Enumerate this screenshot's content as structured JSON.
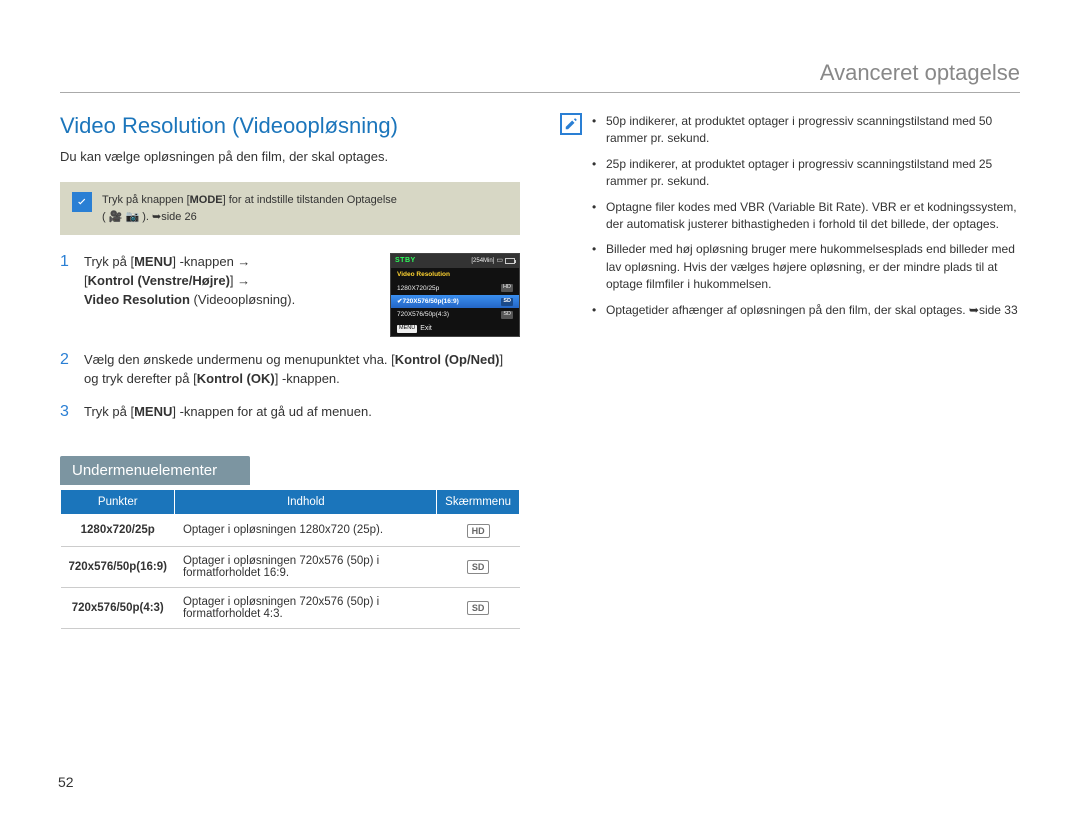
{
  "page_number": "52",
  "chapter_title": "Avanceret optagelse",
  "section_title": "Video Resolution (Videoopløsning)",
  "intro_text": "Du kan vælge opløsningen på den film, der skal optages.",
  "gray_box": {
    "text_prefix": "Tryk på knappen [",
    "mode_label": "MODE",
    "text_suffix": "] for at indstille tilstanden Optagelse",
    "icons_line": "( 🎥 📷 ). ",
    "ref": "➥side 26"
  },
  "steps": {
    "s1": {
      "num": "1",
      "parts": {
        "a": "Tryk på [",
        "menu": "MENU",
        "b": "] -knappen ",
        "arrow1": "→",
        "c": " [",
        "kontrol_lr": "Kontrol (Venstre/Højre)",
        "d": "] ",
        "arrow2": "→",
        "e": " ",
        "vr": "Video Resolution",
        "f": " (Videoopløsning)."
      }
    },
    "s2": {
      "num": "2",
      "parts": {
        "a": "Vælg den ønskede undermenu og menupunktet vha. [",
        "kontrol_ud": "Kontrol (Op/Ned)",
        "b": "] og tryk derefter på [",
        "kontrol_ok": "Kontrol (OK)",
        "c": "] -knappen."
      }
    },
    "s3": {
      "num": "3",
      "parts": {
        "a": "Tryk på [",
        "menu": "MENU",
        "b": "] -knappen for at gå ud af menuen."
      }
    }
  },
  "camera_menu": {
    "stby": "STBY",
    "time": "[254Min]",
    "title": "Video Resolution",
    "items": [
      {
        "label": "1280X720/25p",
        "badge": "HD"
      },
      {
        "label": "720X576/50p(16:9)",
        "badge": "SD"
      },
      {
        "label": "720X576/50p(4:3)",
        "badge": "SD"
      }
    ],
    "menu_btn": "MENU",
    "exit": "Exit"
  },
  "submenu_header": "Undermenuelementer",
  "table": {
    "headers": {
      "punkter": "Punkter",
      "indhold": "Indhold",
      "skaerm": "Skærmmenu"
    },
    "rows": [
      {
        "punkter": "1280x720/25p",
        "indhold": "Optager i opløsningen 1280x720 (25p).",
        "badge": "HD"
      },
      {
        "punkter": "720x576/50p(16:9)",
        "indhold": "Optager i opløsningen 720x576 (50p) i formatforholdet 16:9.",
        "badge": "SD"
      },
      {
        "punkter": "720x576/50p(4:3)",
        "indhold": "Optager i opløsningen 720x576 (50p) i formatforholdet 4:3.",
        "badge": "SD"
      }
    ]
  },
  "notes": [
    "50p indikerer, at produktet optager i progressiv scanningstilstand med 50 rammer pr. sekund.",
    "25p indikerer, at produktet optager i progressiv scanningstilstand med 25 rammer pr. sekund.",
    "Optagne filer kodes med VBR (Variable Bit Rate). VBR er et kodningssystem, der automatisk justerer bithastigheden i forhold til det billede, der optages.",
    "Billeder med høj opløsning bruger mere hukommelsesplads end billeder med lav opløsning. Hvis der vælges højere opløsning, er der mindre plads til at optage filmfiler i hukommelsen.",
    "Optagetider afhænger af opløsningen på den film, der skal optages. ➥side 33"
  ]
}
